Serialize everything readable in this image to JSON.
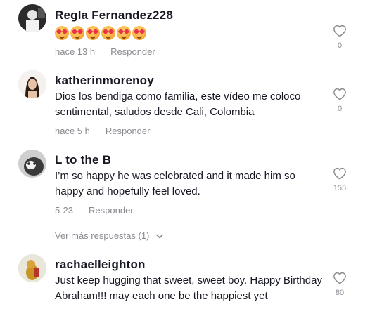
{
  "comments": [
    {
      "username": "Regla Fernandez228",
      "emoji_count": 6,
      "emoji_icon": "smiling-face-with-heart-eyes",
      "time": "hace 13 h",
      "reply_label": "Responder",
      "likes": "0"
    },
    {
      "username": "katherinmorenoy",
      "text": "Dios los bendiga como familia, este vídeo me coloco sentimental, saludos desde Cali, Colombia",
      "time": "hace 5 h",
      "reply_label": "Responder",
      "likes": "0"
    },
    {
      "username": "L to the B",
      "text": "I’m so happy he was celebrated and it made him so happy and hopefully feel loved.",
      "time": "5-23",
      "reply_label": "Responder",
      "likes": "155",
      "more_replies": "Ver más respuestas (1)"
    },
    {
      "username": "rachaelleighton",
      "text": "Just keep hugging that sweet, sweet boy. Happy Birthday Abraham!!! may each one be the happiest yet",
      "likes": "80"
    }
  ],
  "icons": {
    "like": "heart-outline-icon",
    "expand": "chevron-down-icon"
  },
  "colors": {
    "text": "#161823",
    "muted": "#8a8b91",
    "background": "#ffffff"
  }
}
